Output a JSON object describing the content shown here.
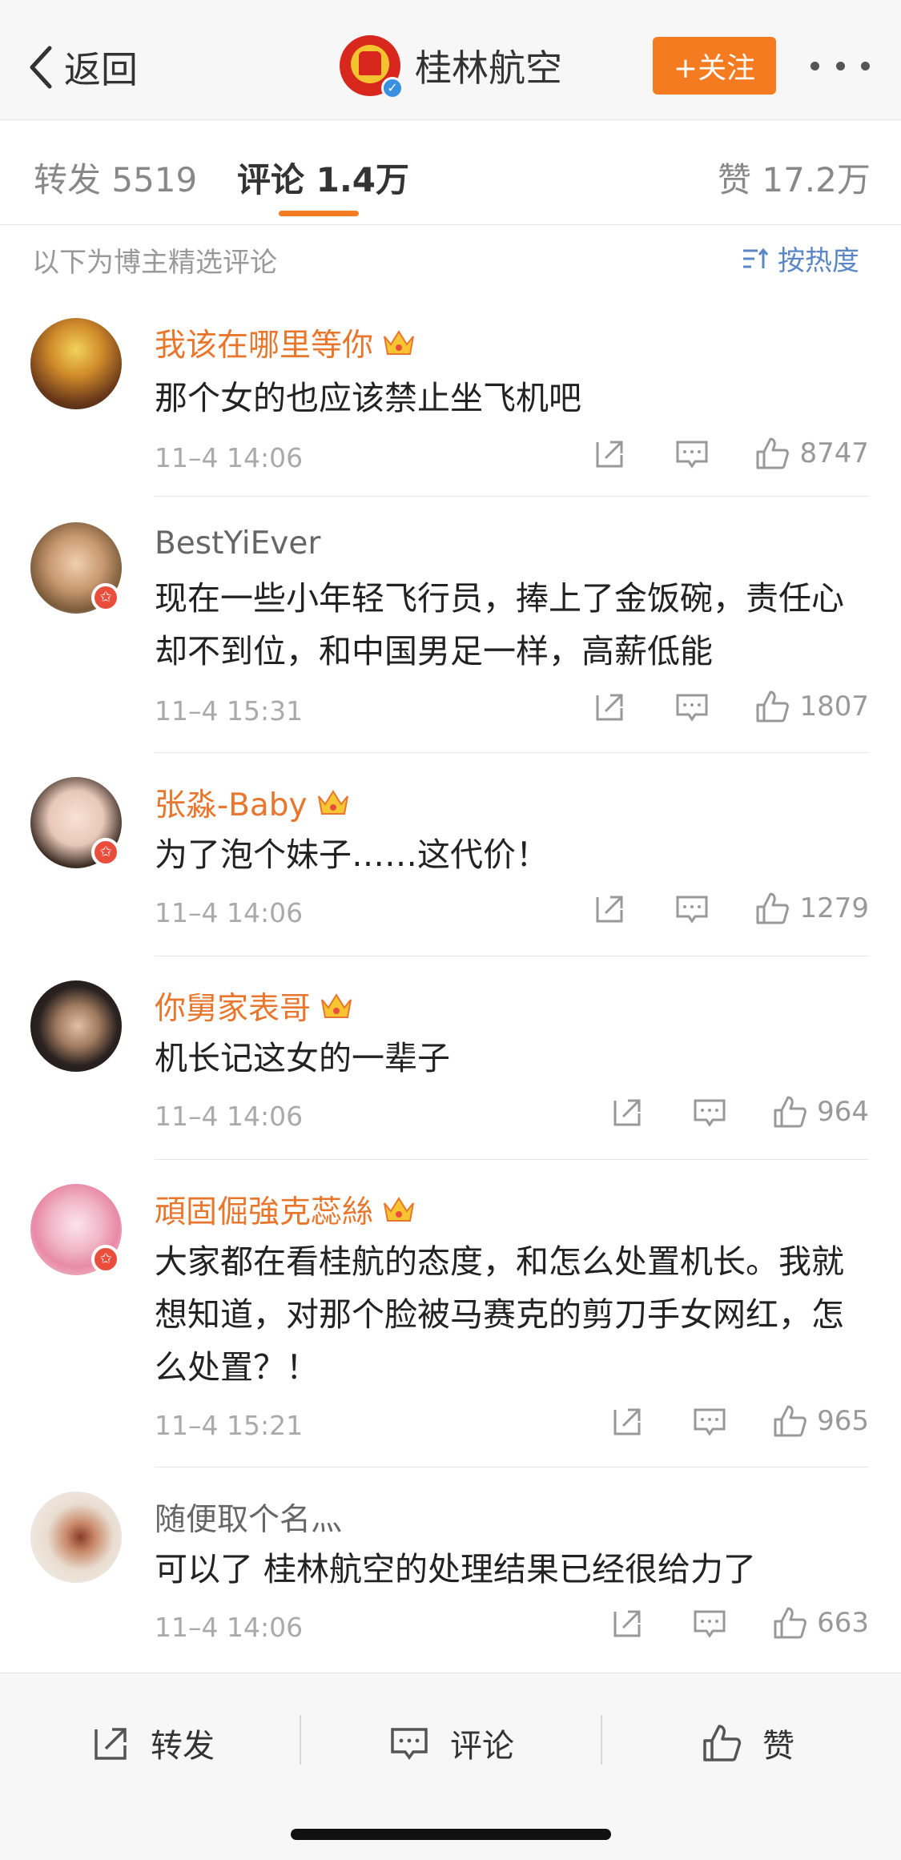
{
  "nav": {
    "back_label": "返回",
    "account_name": "桂林航空",
    "follow_label": "+关注"
  },
  "tabs": {
    "repost": "转发 5519",
    "comment": "评论 1.4万",
    "like": "赞 17.2万"
  },
  "subheader": {
    "note": "以下为博主精选评论",
    "sort_label": "按热度"
  },
  "comments": [
    {
      "name": "我该在哪里等你",
      "vip": true,
      "verified": false,
      "text": "那个女的也应该禁止坐飞机吧",
      "time": "11–4 14:06",
      "likes": "8747"
    },
    {
      "name": "BestYiEver",
      "vip": false,
      "verified": true,
      "text": "现在一些小年轻飞行员，捧上了金饭碗，责任心却不到位，和中国男足一样，高薪低能",
      "time": "11–4 15:31",
      "likes": "1807"
    },
    {
      "name": "张淼-Baby",
      "vip": true,
      "verified": true,
      "text": "为了泡个妹子……这代价！",
      "time": "11–4 14:06",
      "likes": "1279"
    },
    {
      "name": "你舅家表哥",
      "vip": true,
      "verified": false,
      "text": "机长记这女的一辈子",
      "time": "11–4 14:06",
      "likes": "964"
    },
    {
      "name": "頑固倔強克蕊絲",
      "vip": true,
      "verified": true,
      "text": "大家都在看桂航的态度，和怎么处置机长。我就想知道，对那个脸被马赛克的剪刀手女网红，怎么处置？！",
      "time": "11–4 15:21",
      "likes": "965"
    },
    {
      "name": "随便取个名灬",
      "vip": false,
      "verified": false,
      "text": "可以了  桂林航空的处理结果已经很给力了",
      "time": "11–4 14:06",
      "likes": "663"
    }
  ],
  "bottom": {
    "repost": "转发",
    "comment": "评论",
    "like": "赞"
  },
  "colors": {
    "accent_orange": "#f47b20",
    "vip_name": "#e8762d",
    "link_blue": "#5b87c7"
  }
}
